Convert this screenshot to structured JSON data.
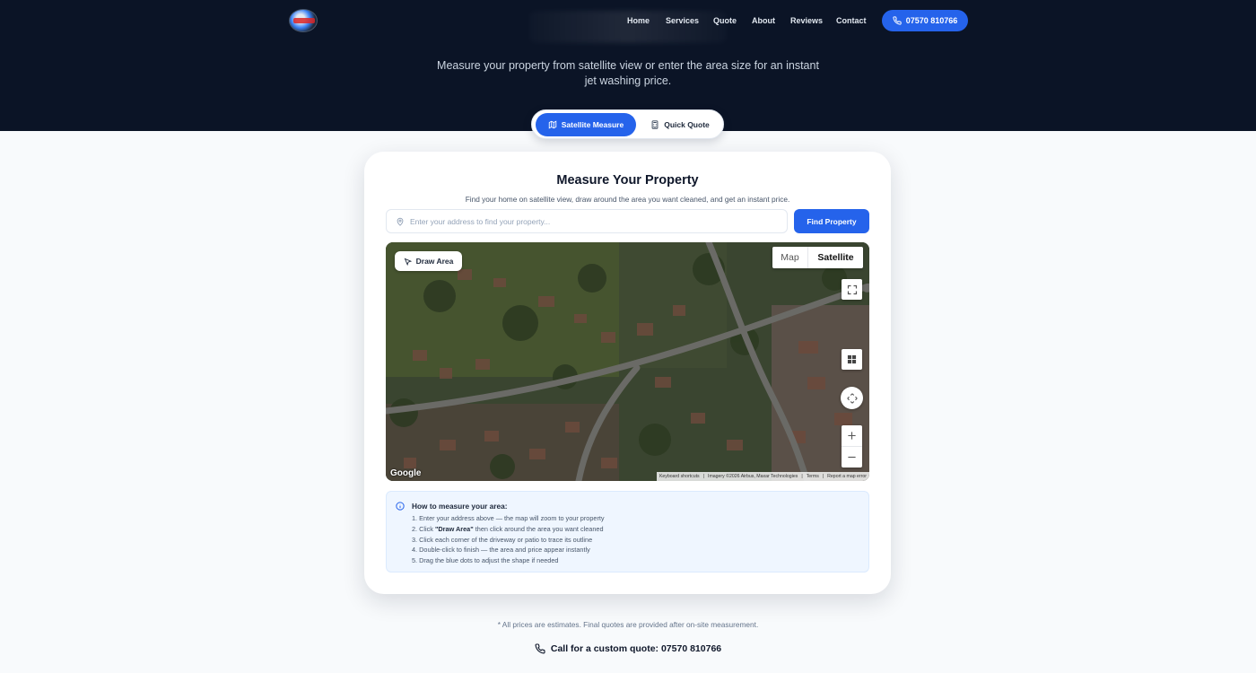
{
  "header": {
    "logo_icon": "power-wash-logo",
    "nav": [
      {
        "label": "Home"
      },
      {
        "label": "Services"
      },
      {
        "label": "Quote"
      },
      {
        "label": "About"
      },
      {
        "label": "Reviews"
      },
      {
        "label": "Contact"
      }
    ],
    "phone_label": "07570 810766",
    "phone_icon": "phone-icon",
    "accent": "#2563eb",
    "background": "#0b1426"
  },
  "hero": {
    "subtitle": "Measure your property from satellite view or enter the area size for an instant jet washing price."
  },
  "tabs": [
    {
      "label": "Satellite Measure",
      "icon": "map-icon",
      "active": true
    },
    {
      "label": "Quick Quote",
      "icon": "calculator-icon",
      "active": false
    }
  ],
  "card": {
    "title": "Measure Your Property",
    "subtitle": "Find your home on satellite view, draw around the area you want cleaned, and get an instant price.",
    "address_placeholder": "Enter your address to find your property...",
    "find_button": "Find Property"
  },
  "map": {
    "draw_button": "Draw Area",
    "type_map": "Map",
    "type_satellite": "Satellite",
    "selected_type": "Satellite",
    "google_logo": "Google",
    "attribution": {
      "shortcuts": "Keyboard shortcuts",
      "imagery": "Imagery ©2026 Airbus, Maxar Technologies",
      "terms": "Terms",
      "report": "Report a map error"
    }
  },
  "instructions": {
    "title": "How to measure your area:",
    "steps": [
      {
        "pre": "1. Enter your address above — the map will zoom to your property",
        "bold": "",
        "post": ""
      },
      {
        "pre": "2. Click ",
        "bold": "\"Draw Area\"",
        "post": " then click around the area you want cleaned"
      },
      {
        "pre": "3. Click each corner of the driveway or patio to trace its outline",
        "bold": "",
        "post": ""
      },
      {
        "pre": "4. Double-click to finish — the area and price appear instantly",
        "bold": "",
        "post": ""
      },
      {
        "pre": "5. Drag the blue dots to adjust the shape if needed",
        "bold": "",
        "post": ""
      }
    ]
  },
  "footer": {
    "note": "* All prices are estimates. Final quotes are provided after on-site measurement.",
    "call": "Call for a custom quote: 07570 810766"
  }
}
